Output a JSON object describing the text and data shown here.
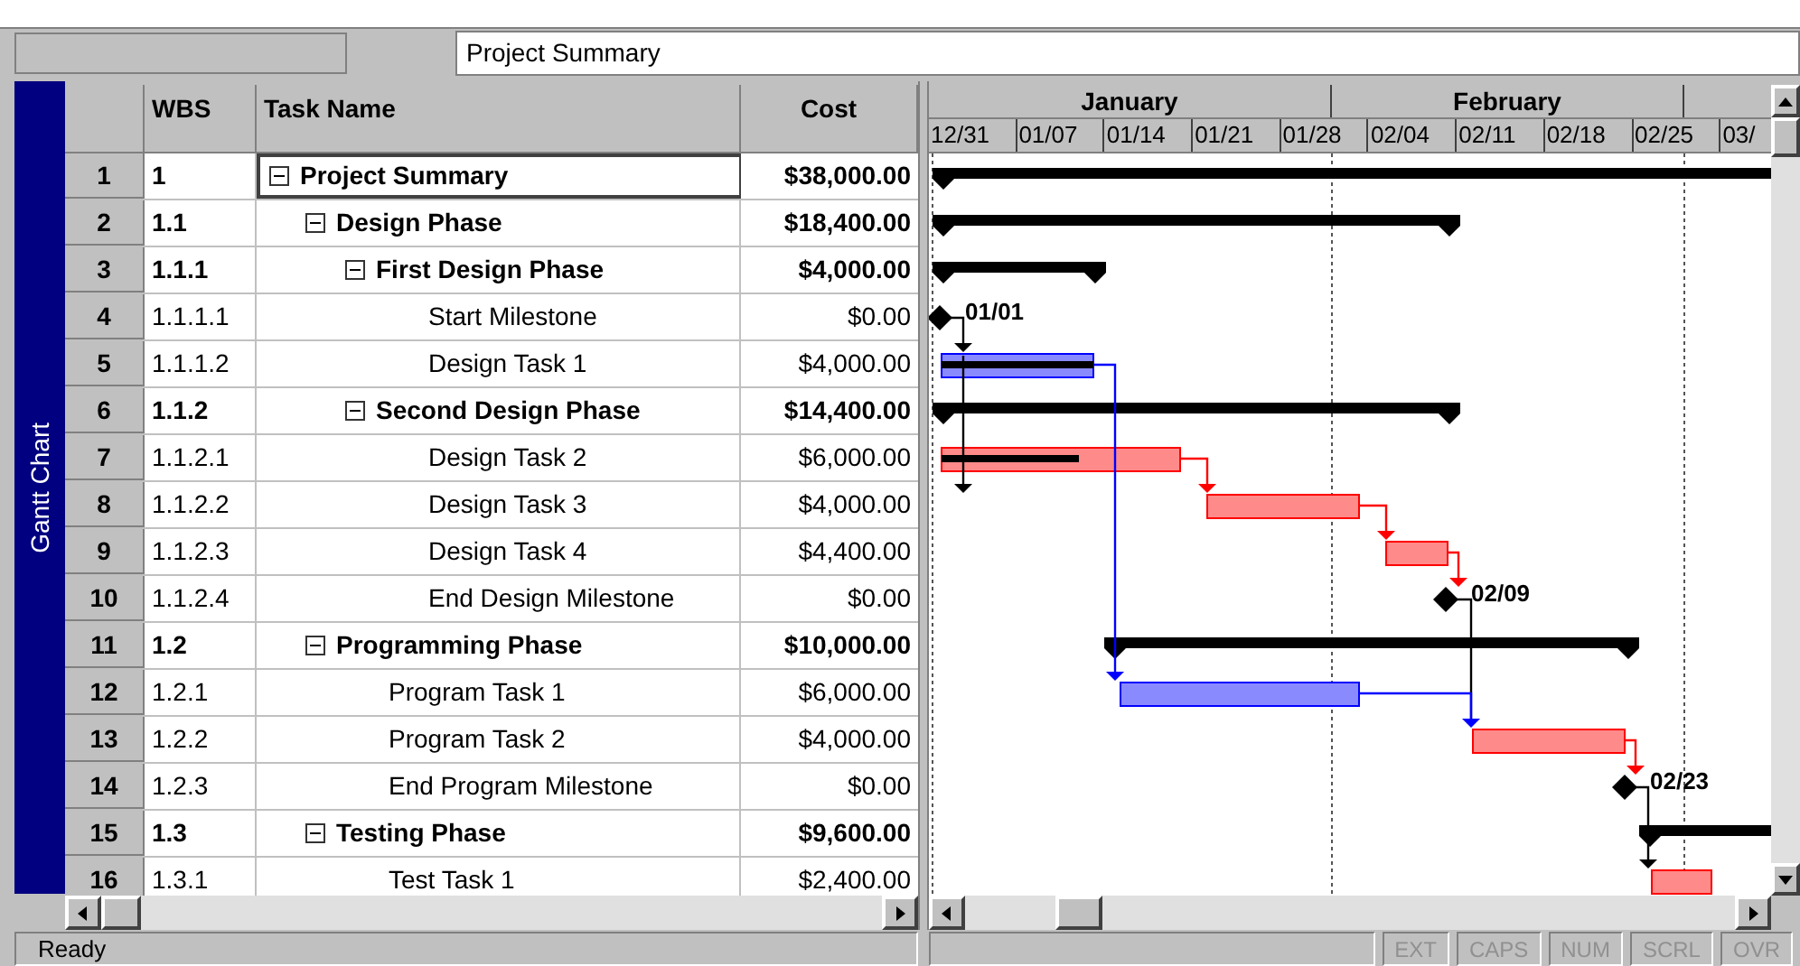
{
  "entry_bar": {
    "value": "Project Summary"
  },
  "sidebar": {
    "label": "Gantt Chart"
  },
  "table": {
    "columns": [
      "WBS",
      "Task Name",
      "Cost"
    ],
    "tasks": [
      {
        "id": "1",
        "wbs": "1",
        "name": "Project Summary",
        "cost": "$38,000.00",
        "kind": "summary",
        "expanded": true,
        "selected": true,
        "children": [
          {
            "id": "2",
            "wbs": "1.1",
            "name": "Design Phase",
            "cost": "$18,400.00",
            "kind": "summary",
            "expanded": true,
            "selected": false,
            "children": [
              {
                "id": "3",
                "wbs": "1.1.1",
                "name": "First Design Phase",
                "cost": "$4,000.00",
                "kind": "summary",
                "expanded": true,
                "selected": false,
                "children": [
                  {
                    "id": "4",
                    "wbs": "1.1.1.1",
                    "name": "Start Milestone",
                    "cost": "$0.00",
                    "kind": "milestone",
                    "date_label": "01/01",
                    "selected": false
                  },
                  {
                    "id": "5",
                    "wbs": "1.1.1.2",
                    "name": "Design Task 1",
                    "cost": "$4,000.00",
                    "kind": "task",
                    "critical": false,
                    "selected": false
                  }
                ]
              },
              {
                "id": "6",
                "wbs": "1.1.2",
                "name": "Second Design Phase",
                "cost": "$14,400.00",
                "kind": "summary",
                "expanded": true,
                "selected": false,
                "children": [
                  {
                    "id": "7",
                    "wbs": "1.1.2.1",
                    "name": "Design Task 2",
                    "cost": "$6,000.00",
                    "kind": "task",
                    "critical": true,
                    "selected": false
                  },
                  {
                    "id": "8",
                    "wbs": "1.1.2.2",
                    "name": "Design Task 3",
                    "cost": "$4,000.00",
                    "kind": "task",
                    "critical": true,
                    "selected": false
                  },
                  {
                    "id": "9",
                    "wbs": "1.1.2.3",
                    "name": "Design Task 4",
                    "cost": "$4,400.00",
                    "kind": "task",
                    "critical": true,
                    "selected": false
                  },
                  {
                    "id": "10",
                    "wbs": "1.1.2.4",
                    "name": "End Design Milestone",
                    "cost": "$0.00",
                    "kind": "milestone",
                    "date_label": "02/09",
                    "selected": false
                  }
                ]
              }
            ]
          },
          {
            "id": "11",
            "wbs": "1.2",
            "name": "Programming Phase",
            "cost": "$10,000.00",
            "kind": "summary",
            "expanded": true,
            "selected": false,
            "children": [
              {
                "id": "12",
                "wbs": "1.2.1",
                "name": "Program Task 1",
                "cost": "$6,000.00",
                "kind": "task",
                "critical": false,
                "selected": false
              },
              {
                "id": "13",
                "wbs": "1.2.2",
                "name": "Program Task 2",
                "cost": "$4,000.00",
                "kind": "task",
                "critical": true,
                "selected": false
              },
              {
                "id": "14",
                "wbs": "1.2.3",
                "name": "End Program Milestone",
                "cost": "$0.00",
                "kind": "milestone",
                "date_label": "02/23",
                "selected": false
              }
            ]
          },
          {
            "id": "15",
            "wbs": "1.3",
            "name": "Testing Phase",
            "cost": "$9,600.00",
            "kind": "summary",
            "expanded": true,
            "selected": false,
            "children": [
              {
                "id": "16",
                "wbs": "1.3.1",
                "name": "Test Task 1",
                "cost": "$2,400.00",
                "kind": "task",
                "critical": true,
                "selected": false
              }
            ]
          }
        ]
      }
    ]
  },
  "timeline": {
    "months": [
      "January",
      "February"
    ],
    "weeks": [
      "12/31",
      "01/07",
      "01/14",
      "01/21",
      "01/28",
      "02/04",
      "02/11",
      "02/18",
      "02/25",
      "03/"
    ]
  },
  "status_bar": {
    "message": "Ready",
    "indicators": [
      {
        "label": "EXT",
        "on": false
      },
      {
        "label": "CAPS",
        "on": false
      },
      {
        "label": "NUM",
        "on": false
      },
      {
        "label": "SCRL",
        "on": false
      },
      {
        "label": "OVR",
        "on": false
      }
    ]
  }
}
